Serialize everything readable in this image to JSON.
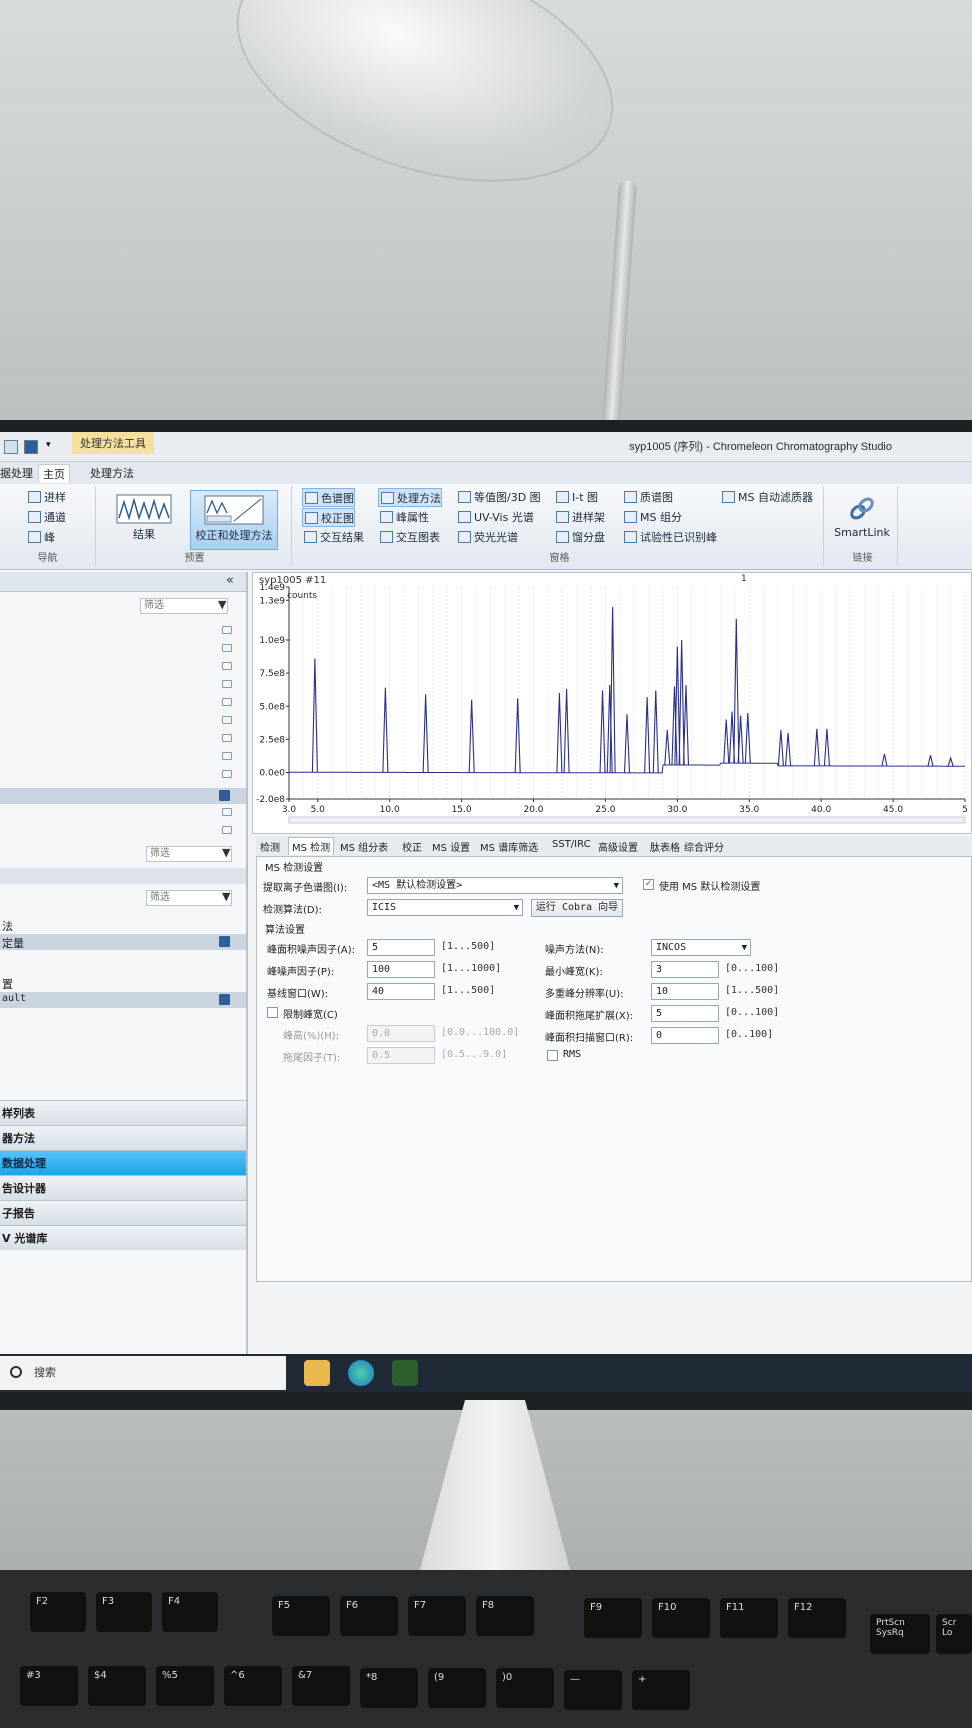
{
  "window": {
    "title": "syp1005 (序列) - Chromeleon Chromatography Studio",
    "tools_tab": "处理方法工具"
  },
  "ribbon_tabs": [
    {
      "label": "据处理"
    },
    {
      "label": "主页"
    },
    {
      "label": "处理方法"
    }
  ],
  "ribbon": {
    "nav_group": {
      "label": "导航",
      "items": [
        "进样",
        "通道",
        "峰"
      ]
    },
    "preset_group": {
      "label": "预置",
      "results": "结果",
      "calib": "校正和处理方法"
    },
    "pane_group": {
      "label": "窗格",
      "items": [
        "色谱图",
        "校正图",
        "交互结果",
        "处理方法",
        "峰属性",
        "交互图表",
        "等值图/3D 图",
        "UV-Vis 光谱",
        "荧光光谱",
        "I-t 图",
        "进样架",
        "馏分盘",
        "质谱图",
        "MS 组分",
        "试验性已识别峰",
        "MS 自动滤质器"
      ]
    },
    "link_group": {
      "label": "链接",
      "smartlink": "SmartLink"
    }
  },
  "left_panel": {
    "filter_placeholder": "筛选",
    "lines": [
      "法",
      "定量",
      "置",
      "ault"
    ],
    "nav": [
      "样列表",
      "器方法",
      "数据处理",
      "告设计器",
      "子报告",
      "V 光谱库"
    ]
  },
  "chart": {
    "title": "syp1005 #11",
    "peak_flag": "1",
    "y_unit": "counts",
    "y_ticks": [
      "1.4e9",
      "1.3e9",
      "1.0e9",
      "7.5e8",
      "5.0e8",
      "2.5e8",
      "0.0e0",
      "-2.0e8"
    ],
    "x_ticks": [
      "3.0",
      "5.0",
      "10.0",
      "15.0",
      "20.0",
      "25.0",
      "30.0",
      "35.0",
      "40.0",
      "45.0",
      "5"
    ],
    "peak_color": "#2a2f8a"
  },
  "chart_data": {
    "type": "line",
    "title": "",
    "xlabel": "",
    "ylabel": "counts",
    "xlim": [
      3.0,
      50.0
    ],
    "ylim": [
      -200000000.0,
      1400000000.0
    ],
    "series": [
      {
        "x": [
          4.8,
          9.7,
          12.5,
          15.7,
          18.9,
          21.8,
          22.3,
          24.8,
          25.3,
          25.5,
          26.5,
          27.9,
          28.5,
          29.3,
          29.8,
          30.0,
          30.3,
          30.6,
          33.4,
          33.8,
          34.1,
          34.4,
          34.9,
          37.2,
          37.7,
          39.7,
          40.4,
          44.4,
          47.6,
          49.0
        ],
        "y": [
          860000000.0,
          640000000.0,
          590000000.0,
          550000000.0,
          560000000.0,
          600000000.0,
          630000000.0,
          620000000.0,
          660000000.0,
          1250000000.0,
          440000000.0,
          570000000.0,
          620000000.0,
          320000000.0,
          650000000.0,
          950000000.0,
          1000000000.0,
          660000000.0,
          400000000.0,
          460000000.0,
          1160000000.0,
          430000000.0,
          450000000.0,
          320000000.0,
          300000000.0,
          330000000.0,
          330000000.0,
          140000000.0,
          130000000.0,
          110000000.0
        ]
      }
    ]
  },
  "tabs": [
    "检测",
    "MS 检测",
    "MS 组分表",
    "校正",
    "MS 设置",
    "MS 谱库筛选",
    "SST/IRC",
    "高级设置",
    "肽表格",
    "综合评分"
  ],
  "settings": {
    "group_title": "MS 检测设置",
    "extract_label": "提取离子色谱图(I):",
    "extract_value": "<MS 默认检测设置>",
    "use_default_label": "使用 MS 默认检测设置",
    "algo_label": "检测算法(D):",
    "algo_value": "ICIS",
    "cobra_button": "运行 Cobra 向导",
    "algo_section": "算法设置",
    "rows_left": [
      {
        "label": "峰面积噪声因子(A):",
        "value": "5",
        "range": "[1...500]"
      },
      {
        "label": "峰噪声因子(P):",
        "value": "100",
        "range": "[1...1000]"
      },
      {
        "label": "基线窗口(W):",
        "value": "40",
        "range": "[1...500]"
      }
    ],
    "constrain_label": "限制峰宽(C)",
    "rows_left_dim": [
      {
        "label": "峰高(%)(H):",
        "value": "0.0",
        "range": "[0.0...100.0]"
      },
      {
        "label": "拖尾因子(T):",
        "value": "0.5",
        "range": "[0.5...9.0]"
      }
    ],
    "noise_method_label": "噪声方法(N):",
    "noise_method_value": "INCOS",
    "rows_right": [
      {
        "label": "最小峰宽(K):",
        "value": "3",
        "range": "[0...100]"
      },
      {
        "label": "多重峰分辨率(U):",
        "value": "10",
        "range": "[1...500]"
      },
      {
        "label": "峰面积拖尾扩展(X):",
        "value": "5",
        "range": "[0...100]"
      },
      {
        "label": "峰面积扫描窗口(R):",
        "value": "0",
        "range": "[0..100]"
      }
    ],
    "rms_label": "RMS"
  },
  "taskbar": {
    "search": "搜索"
  },
  "keyboard": {
    "fkeys": [
      "F2",
      "F3",
      "F4",
      "F5",
      "F6",
      "F7",
      "F8",
      "F9",
      "F10",
      "F11",
      "F12"
    ],
    "right_keys": [
      "PrtScn SysRq",
      "Scr Lo"
    ],
    "num_keys": [
      "#3",
      "$4",
      "%5",
      "^6",
      "&7",
      "*8",
      "(9",
      ")0",
      "—",
      "+"
    ]
  }
}
